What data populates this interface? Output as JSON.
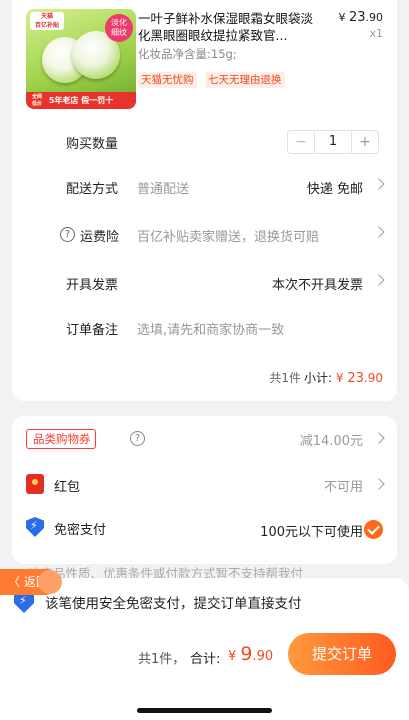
{
  "product": {
    "title": "一叶子鲜补水保湿眼霜女眼袋淡化黑眼圈眼纹提拉紧致官...",
    "spec": "化妆品净含量:15g;",
    "tags": [
      "天猫无忧购",
      "七天无理由退换"
    ],
    "price_symbol": "¥",
    "price_int": "23",
    "price_dec": ".90",
    "quantity_label": "x1",
    "thumb": {
      "brand_text": "天猫\n百亿补贴",
      "badge_text": "淡化\n细纹",
      "strip_mini": "全网\n低价",
      "strip_text": "5年老店 假一罚十"
    }
  },
  "purchase_qty": {
    "label": "购买数量",
    "value": "1",
    "minus": "−",
    "plus": "+"
  },
  "delivery": {
    "label": "配送方式",
    "value": "普通配送",
    "right": "快递 免邮"
  },
  "insurance": {
    "label": "运费险",
    "value": "百亿补贴卖家赠送，退换货可赔",
    "help": "?"
  },
  "invoice": {
    "label": "开具发票",
    "right": "本次不开具发票"
  },
  "note": {
    "label": "订单备注",
    "placeholder": "选填,请先和商家协商一致"
  },
  "subtotal": {
    "count": "共1件",
    "label": "小计:",
    "symbol": "¥",
    "int": "23",
    "dec": ".90"
  },
  "coupon": {
    "label": "品类购物券",
    "help": "?",
    "value": "减14.00元"
  },
  "redpacket": {
    "label": "红包",
    "value": "不可用"
  },
  "nopwd": {
    "label": "免密支付",
    "value": "100元以下可使用"
  },
  "faded_note": "该商品性质、优惠条件或付款方式暂不支持帮我付",
  "back": {
    "label": "〈 返回"
  },
  "bottom": {
    "message": "该笔使用安全免密支付，提交订单直接支付",
    "count": "共1件，",
    "total_label": "合计:",
    "symbol": "¥",
    "int": "9",
    "dec": ".90",
    "submit": "提交订单"
  },
  "colors": {
    "accent": "#f04a22",
    "button": "#ff6a1a",
    "shield": "#2b6de8"
  }
}
